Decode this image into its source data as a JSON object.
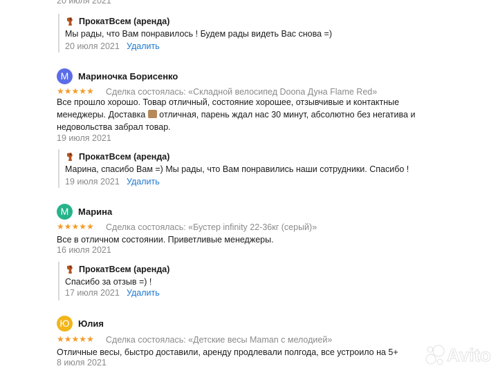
{
  "owner_name": "ПрокатВсем (аренда)",
  "delete_label": "Удалить",
  "top": {
    "date": "20 июля 2021"
  },
  "reply0": {
    "text": "Мы рады, что Вам понравилось ! Будем рады видеть Вас снова =)",
    "date": "20 июля 2021"
  },
  "reviews": [
    {
      "avatar_letter": "М",
      "avatar_color": "#5b6de8",
      "author": "Мариночка Борисенко",
      "stars": "★★★★★",
      "deal": "Сделка состоялась: «Складной велосипед Doona Дуна Flame Red»",
      "text_lines": [
        "Все прошло хорошо. Товар отличный, состояние хорошее, отзывчивые и контактные",
        "менеджеры. Доставка",
        "отличная, парень ждал нас 30 минут, абсолютно без негатива и",
        "недовольства забрал товар."
      ],
      "date": "19 июля 2021",
      "reply": {
        "text": "Марина, спасибо Вам =) Мы рады, что Вам понравились наши сотрудники. Спасибо !",
        "date": "19 июля 2021"
      }
    },
    {
      "avatar_letter": "М",
      "avatar_color": "#26b38a",
      "author": "Марина",
      "stars": "★★★★★",
      "deal": "Сделка состоялась: «Бустер infinity 22-36кг (серый)»",
      "text_lines": [
        "Все в отличном состоянии. Приветливые менеджеры."
      ],
      "date": "16 июля 2021",
      "reply": {
        "text": "Спасибо за отзыв =) !",
        "date": "17 июля 2021"
      }
    },
    {
      "avatar_letter": "Ю",
      "avatar_color": "#f2b51b",
      "author": "Юлия",
      "stars": "★★★★★",
      "deal": "Сделка состоялась: «Детские весы Maman с мелодией»",
      "text_lines": [
        "Отличные весы, быстро доставили, аренду продлевали полгода, все устроило на 5+"
      ],
      "date": "8 июля 2021"
    }
  ],
  "watermark": "Avito"
}
